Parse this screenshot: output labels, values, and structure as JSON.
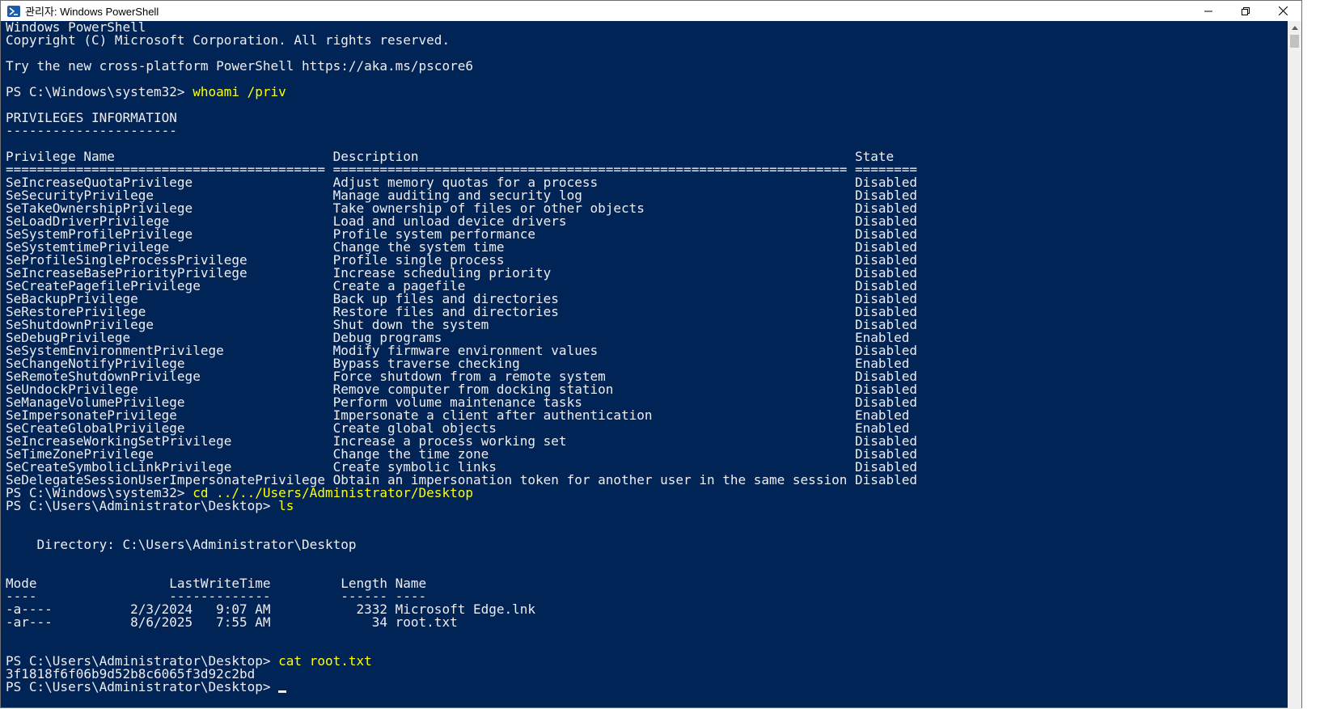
{
  "window": {
    "title": "관리자: Windows PowerShell",
    "icons": {
      "app": "powershell-icon",
      "minimize": "minimize-icon",
      "restore": "restore-icon",
      "close": "close-icon"
    }
  },
  "console": {
    "lines": [
      {
        "text": "Windows PowerShell"
      },
      {
        "text": "Copyright (C) Microsoft Corporation. All rights reserved."
      },
      {
        "text": ""
      },
      {
        "text": "Try the new cross-platform PowerShell https://aka.ms/pscore6"
      },
      {
        "text": ""
      },
      {
        "prompt": "PS C:\\Windows\\system32> ",
        "cmd": "whoami /priv"
      },
      {
        "text": ""
      },
      {
        "text": "PRIVILEGES INFORMATION"
      },
      {
        "text": "----------------------"
      },
      {
        "text": ""
      },
      {
        "text": "Privilege Name                            Description                                                        State"
      },
      {
        "text": "========================================= ================================================================== ========"
      },
      {
        "text": "SeIncreaseQuotaPrivilege                  Adjust memory quotas for a process                                 Disabled"
      },
      {
        "text": "SeSecurityPrivilege                       Manage auditing and security log                                   Disabled"
      },
      {
        "text": "SeTakeOwnershipPrivilege                  Take ownership of files or other objects                           Disabled"
      },
      {
        "text": "SeLoadDriverPrivilege                     Load and unload device drivers                                     Disabled"
      },
      {
        "text": "SeSystemProfilePrivilege                  Profile system performance                                         Disabled"
      },
      {
        "text": "SeSystemtimePrivilege                     Change the system time                                             Disabled"
      },
      {
        "text": "SeProfileSingleProcessPrivilege           Profile single process                                             Disabled"
      },
      {
        "text": "SeIncreaseBasePriorityPrivilege           Increase scheduling priority                                       Disabled"
      },
      {
        "text": "SeCreatePagefilePrivilege                 Create a pagefile                                                  Disabled"
      },
      {
        "text": "SeBackupPrivilege                         Back up files and directories                                      Disabled"
      },
      {
        "text": "SeRestorePrivilege                        Restore files and directories                                      Disabled"
      },
      {
        "text": "SeShutdownPrivilege                       Shut down the system                                               Disabled"
      },
      {
        "text": "SeDebugPrivilege                          Debug programs                                                     Enabled"
      },
      {
        "text": "SeSystemEnvironmentPrivilege              Modify firmware environment values                                 Disabled"
      },
      {
        "text": "SeChangeNotifyPrivilege                   Bypass traverse checking                                           Enabled"
      },
      {
        "text": "SeRemoteShutdownPrivilege                 Force shutdown from a remote system                                Disabled"
      },
      {
        "text": "SeUndockPrivilege                         Remove computer from docking station                               Disabled"
      },
      {
        "text": "SeManageVolumePrivilege                   Perform volume maintenance tasks                                   Disabled"
      },
      {
        "text": "SeImpersonatePrivilege                    Impersonate a client after authentication                          Enabled"
      },
      {
        "text": "SeCreateGlobalPrivilege                   Create global objects                                              Enabled"
      },
      {
        "text": "SeIncreaseWorkingSetPrivilege             Increase a process working set                                     Disabled"
      },
      {
        "text": "SeTimeZonePrivilege                       Change the time zone                                               Disabled"
      },
      {
        "text": "SeCreateSymbolicLinkPrivilege             Create symbolic links                                              Disabled"
      },
      {
        "text": "SeDelegateSessionUserImpersonatePrivilege Obtain an impersonation token for another user in the same session Disabled"
      },
      {
        "prompt": "PS C:\\Windows\\system32> ",
        "cmd": "cd ../../Users/Administrator/Desktop"
      },
      {
        "prompt": "PS C:\\Users\\Administrator\\Desktop> ",
        "cmd": "ls"
      },
      {
        "text": ""
      },
      {
        "text": ""
      },
      {
        "text": "    Directory: C:\\Users\\Administrator\\Desktop"
      },
      {
        "text": ""
      },
      {
        "text": ""
      },
      {
        "text": "Mode                 LastWriteTime         Length Name"
      },
      {
        "text": "----                 -------------         ------ ----"
      },
      {
        "text": "-a----          2/3/2024   9:07 AM           2332 Microsoft Edge.lnk"
      },
      {
        "text": "-ar---          8/6/2025   7:55 AM             34 root.txt"
      },
      {
        "text": ""
      },
      {
        "text": ""
      },
      {
        "prompt": "PS C:\\Users\\Administrator\\Desktop> ",
        "cmd": "cat root.txt"
      },
      {
        "text": "3f1818f6f06b9d52b8c6065f3d92c2bd"
      },
      {
        "prompt": "PS C:\\Users\\Administrator\\Desktop> ",
        "cmd": "",
        "cursor": true
      }
    ]
  },
  "colors": {
    "background": "#012456",
    "foreground": "#eeedf0",
    "command": "#ffff00"
  }
}
